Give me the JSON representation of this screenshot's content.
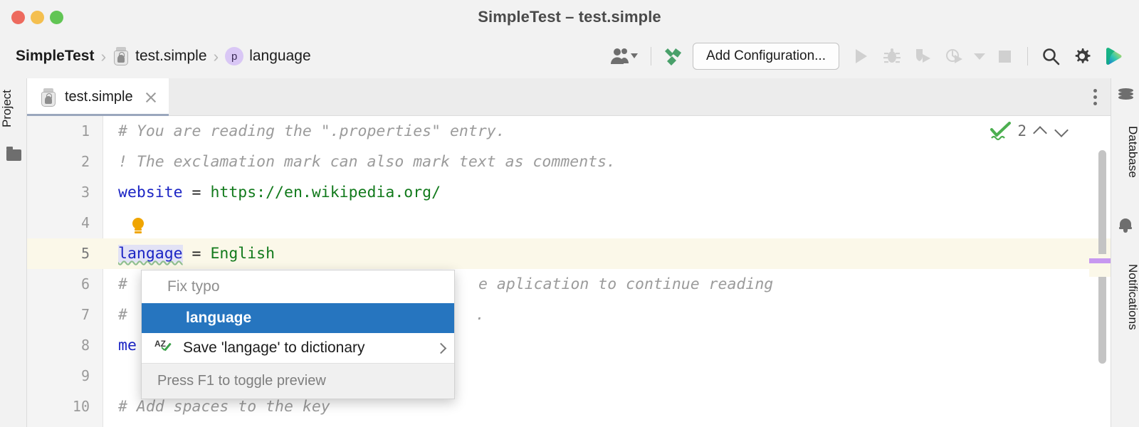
{
  "window": {
    "title": "SimpleTest – test.simple",
    "traffic_lights": [
      "close",
      "minimize",
      "zoom"
    ]
  },
  "breadcrumb": {
    "root": "SimpleTest",
    "separator": "›",
    "items": [
      {
        "label": "test.simple",
        "icon": "properties-file-icon"
      },
      {
        "label": "language",
        "icon": "property-key-badge",
        "badge": "p"
      }
    ]
  },
  "toolbar": {
    "avatar_dropdown": {
      "name": "user-avatar-dropdown",
      "icon": "person-icon"
    },
    "build_label": "",
    "build_icon": "hammer-icon",
    "add_configuration": "Add Configuration...",
    "buttons": [
      {
        "name": "run-button",
        "icon": "play-icon",
        "enabled": false
      },
      {
        "name": "debug-button",
        "icon": "bug-icon",
        "enabled": false
      },
      {
        "name": "run-with-coverage-button",
        "icon": "coverage-icon",
        "enabled": false
      },
      {
        "name": "profiler-button",
        "icon": "profiler-icon",
        "enabled": false
      },
      {
        "name": "stop-button",
        "icon": "stop-square-icon",
        "enabled": false
      },
      {
        "name": "search-everywhere-button",
        "icon": "magnifier-icon",
        "enabled": true
      },
      {
        "name": "settings-button",
        "icon": "gear-icon",
        "enabled": true
      },
      {
        "name": "ide-assistant-button",
        "icon": "gradient-play-icon",
        "enabled": true
      }
    ]
  },
  "left_strip": {
    "tool_label": "Project",
    "folder_icon": "folder-icon"
  },
  "right_strip": {
    "database_label": "Database",
    "database_icon": "database-cylinder-icon",
    "notifications_label": "Notifications",
    "notifications_icon": "bell-icon"
  },
  "tabs": {
    "active": "test.simple",
    "items": [
      {
        "label": "test.simple",
        "icon": "properties-file-icon",
        "closable": true
      }
    ],
    "overflow_menu": "tab-options-menu"
  },
  "editor": {
    "inspection_count": "2",
    "inspection_icon": "spellcheck-ok-icon",
    "lines": [
      {
        "num": "1",
        "kind": "comment",
        "text": "# You are reading the \".properties\" entry."
      },
      {
        "num": "2",
        "kind": "comment",
        "text": "! The exclamation mark can also mark text as comments."
      },
      {
        "num": "3",
        "kind": "kv",
        "key": "website",
        "eq": " = ",
        "value": "https://en.wikipedia.org/"
      },
      {
        "num": "4",
        "kind": "blank",
        "text": ""
      },
      {
        "num": "5",
        "kind": "kv-typo",
        "key": "langage",
        "eq": " = ",
        "value": "English",
        "highlighted": true
      },
      {
        "num": "6",
        "kind": "comment-typo",
        "pre": "# ",
        "hidden_mid": "",
        "typo": "aplication",
        "post": " to continue reading"
      },
      {
        "num": "7",
        "kind": "comment",
        "text": "#"
      },
      {
        "num": "8",
        "kind": "kv",
        "key": "me",
        "eq": "",
        "value": ""
      },
      {
        "num": "9",
        "kind": "blank",
        "text": ""
      },
      {
        "num": "10",
        "kind": "comment",
        "text": "# Add spaces to the key"
      }
    ],
    "line6_tail": "e aplication to continue reading",
    "line7_tail": ".",
    "bulb_icon": "intention-bulb-icon",
    "scrollbar_marker_color": "#c798f0"
  },
  "popup": {
    "title": "Fix typo",
    "items": [
      {
        "label": "language",
        "selected": true,
        "icon": null
      },
      {
        "label": "Save 'langage' to dictionary",
        "selected": false,
        "icon": "spellcheck-dictionary-icon",
        "has_submenu": true
      }
    ],
    "footer": "Press F1 to toggle preview"
  },
  "colors": {
    "accent_selection": "#2675bf",
    "comment": "#9b9b9b",
    "key": "#1b24c4",
    "value": "#127a1c",
    "highlight_line": "#fbf8e9",
    "bulb": "#f0a500",
    "hammer": "#49a06a"
  }
}
